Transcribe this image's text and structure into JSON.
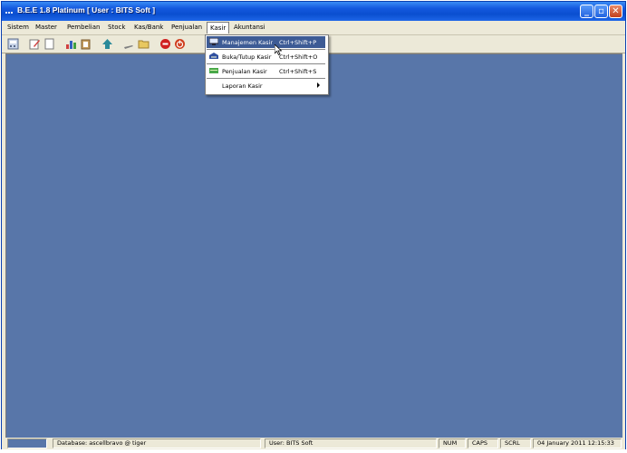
{
  "window": {
    "title": "B.E.E 1.8 Platinum [ User : BITS Soft ]",
    "controls": {
      "minimize": "_",
      "maximize": "▫",
      "close": "✕"
    }
  },
  "menubar": {
    "items": [
      {
        "label": "Sistem"
      },
      {
        "label": "Master"
      },
      {
        "label": "Pembelian"
      },
      {
        "label": "Stock"
      },
      {
        "label": "Kas/Bank"
      },
      {
        "label": "Penjualan"
      },
      {
        "label": "Kasir"
      },
      {
        "label": "Akuntansi"
      }
    ],
    "active": "Kasir"
  },
  "toolbar": {
    "icons": [
      "calculator-icon",
      "edit-icon",
      "blank-page-icon",
      "chart-icon",
      "clipboard-icon",
      "arrow-up-icon",
      "pen-icon",
      "folder-icon",
      "stop-icon",
      "power-icon"
    ]
  },
  "dropdown": {
    "items": [
      {
        "label": "Manajemen Kasir",
        "shortcut": "Ctrl+Shift+P",
        "icon": "monitor-icon",
        "highlighted": true
      },
      {
        "label": "Buka/Tutup Kasir",
        "shortcut": "Ctrl+Shift+O",
        "icon": "drawer-icon"
      },
      {
        "label": "Penjualan Kasir",
        "shortcut": "Ctrl+Shift+S",
        "icon": "register-icon"
      },
      {
        "label": "Laporan Kasir",
        "shortcut": "",
        "icon": "",
        "submenu": true
      }
    ]
  },
  "statusbar": {
    "database": "Database: ascellbravo @ tiger",
    "user": "User: BITS Soft",
    "num": "NUM",
    "caps": "CAPS",
    "scrl": "SCRL",
    "datetime": "04 January 2011  12:15:33"
  },
  "colors": {
    "workspace": "#5876a9",
    "titlebar": "#0a4fd0",
    "menu_highlight": "#3d5b95"
  }
}
